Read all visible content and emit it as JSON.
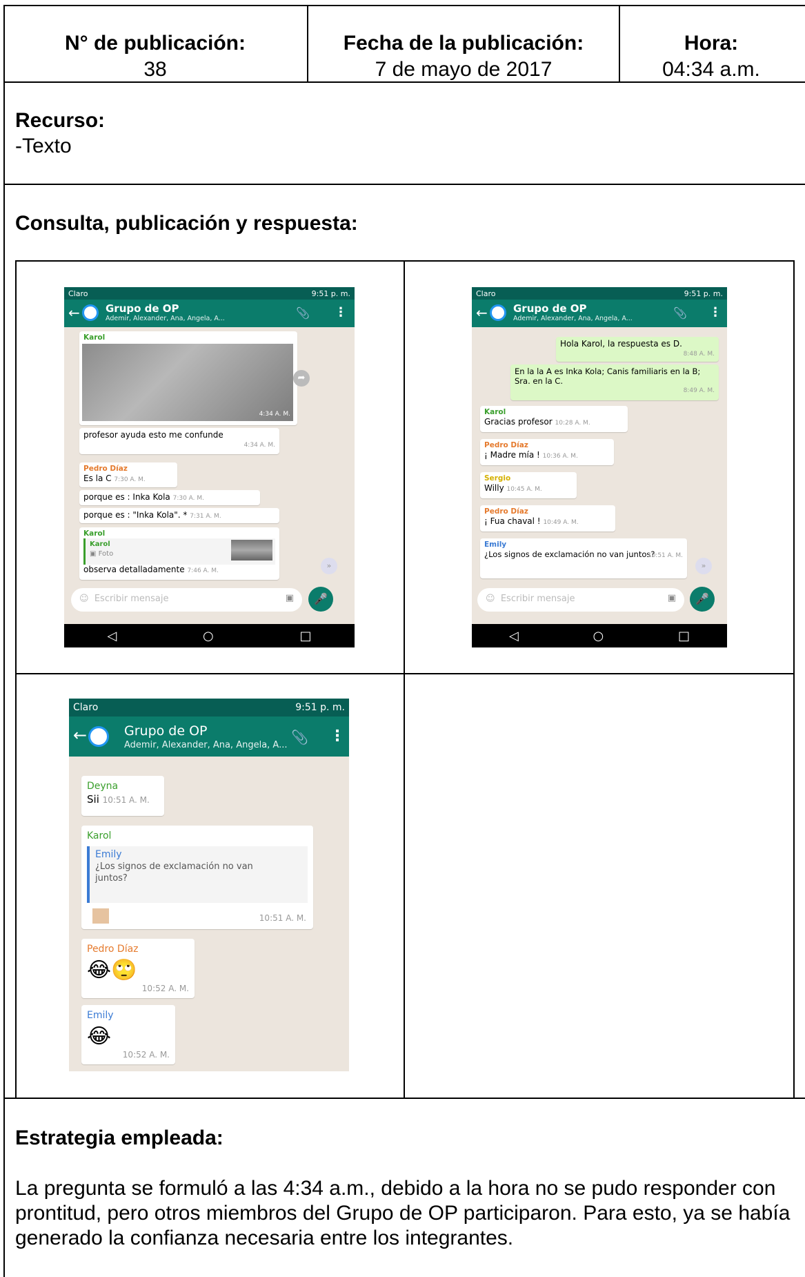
{
  "header": {
    "pub_no_label": "N°  de publicación:",
    "pub_no_value": "38",
    "date_label": "Fecha de la publicación:",
    "date_value": "7 de mayo de 2017",
    "time_label": "Hora:",
    "time_value": "04:34 a.m."
  },
  "recurso": {
    "label": "Recurso:",
    "value": "-Texto"
  },
  "consulta": {
    "label": "Consulta, publicación y respuesta:"
  },
  "phone_common": {
    "carrier": "Claro",
    "clock": "9:51 p. m.",
    "group_title": "Grupo de OP",
    "group_members": "Ademir, Alexander, Ana, Angela, A...",
    "input_placeholder": "Escribir mensaje"
  },
  "screenshot1": {
    "m1_name": "Karol",
    "m1_time": "4:34 A. M.",
    "m2_text": "profesor ayuda esto me confunde",
    "m2_time": "4:34 A. M.",
    "m3_name": "Pedro Díaz",
    "m3_text": "Es la C",
    "m3_time": "7:30 A. M.",
    "m4_text": "porque es : Inka Kola",
    "m4_time": "7:30 A. M.",
    "m5_text": "porque es : \"Inka Kola\". *",
    "m5_time": "7:31 A. M.",
    "m6_name": "Karol",
    "m6_quote_name": "Karol",
    "m6_quote_text": "Foto",
    "m6_text": "observa detalladamente",
    "m6_time": "7:46 A. M."
  },
  "screenshot2": {
    "m1_text": "Hola Karol, la respuesta es D.",
    "m1_time": "8:48 A. M.",
    "m2_text": "En la la A es Inka Kola; Canis familiaris en la B; Sra. en la C.",
    "m2_time": "8:49 A. M.",
    "m3_name": "Karol",
    "m3_text": "Gracias  profesor",
    "m3_time": "10:28 A. M.",
    "m4_name": "Pedro Díaz",
    "m4_text": "¡ Madre mía !",
    "m4_time": "10:36 A. M.",
    "m5_name": "Sergio",
    "m5_text": "Willy",
    "m5_time": "10:45 A. M.",
    "m6_name": "Pedro Díaz",
    "m6_text": "¡ Fua chaval !",
    "m6_time": "10:49 A. M.",
    "m7_name": "Emily",
    "m7_text": "¿Los signos de exclamación no van juntos?",
    "m7_time": "10:51 A. M."
  },
  "screenshot3": {
    "m1_name": "Deyna",
    "m1_text": "Sii",
    "m1_time": "10:51 A. M.",
    "m2_name": "Karol",
    "m2_quote_name": "Emily",
    "m2_quote_text": "¿Los signos de exclamación no van juntos?",
    "m2_time": "10:51 A. M.",
    "m3_name": "Pedro Díaz",
    "m3_text": "😂🙄",
    "m3_time": "10:52 A. M.",
    "m4_name": "Emily",
    "m4_text": "😂",
    "m4_time": "10:52 A. M."
  },
  "estrategia": {
    "label": "Estrategia empleada:",
    "text": "La pregunta se formuló a las 4:34 a.m., debido a la hora no se pudo responder con prontitud, pero otros miembros del Grupo de OP participaron. Para esto, ya se había generado la confianza necesaria entre los integrantes."
  },
  "colors": {
    "whatsapp_green": "#0b7c6b",
    "chat_bg": "#ece5dd",
    "out_bubble": "#dcf8c6"
  }
}
